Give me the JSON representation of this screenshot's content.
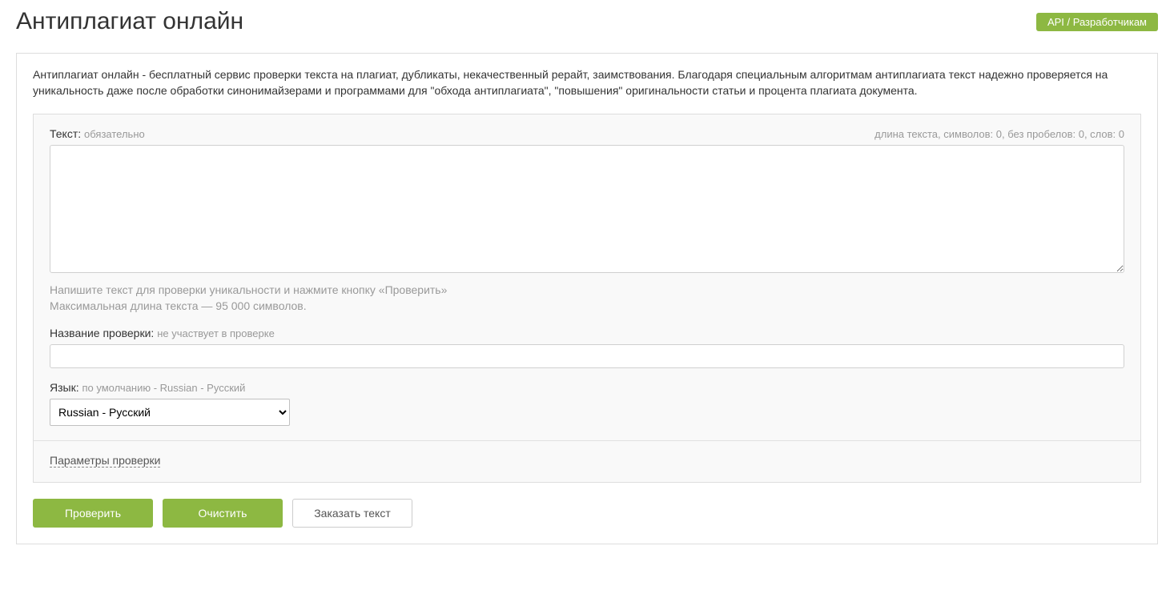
{
  "header": {
    "title": "Антиплагиат онлайн",
    "api_button": "API / Разработчикам"
  },
  "intro": "Антиплагиат онлайн - бесплатный сервис проверки текста на плагиат, дубликаты, некачественный рерайт, заимствования. Благодаря специальным алгоритмам антиплагиата текст надежно проверяется на уникальность даже после обработки синонимайзерами и программами для \"обхода антиплагиата\", \"повышения\" оригинальности статьи и процента плагиата документа.",
  "form": {
    "text_label": "Текст:",
    "text_required": "обязательно",
    "stats": "длина текста, символов: 0, без пробелов: 0, слов: 0",
    "text_value": "",
    "help_line1": "Напишите текст для проверки уникальности и нажмите кнопку «Проверить»",
    "help_line2": "Максимальная длина текста — 95 000 символов.",
    "name_label": "Название проверки:",
    "name_hint": "не участвует в проверке",
    "name_value": "",
    "lang_label": "Язык:",
    "lang_hint": "по умолчанию - Russian - Русский",
    "lang_selected": "Russian - Русский",
    "params_link": "Параметры проверки"
  },
  "buttons": {
    "check": "Проверить",
    "clear": "Очистить",
    "order": "Заказать текст"
  }
}
